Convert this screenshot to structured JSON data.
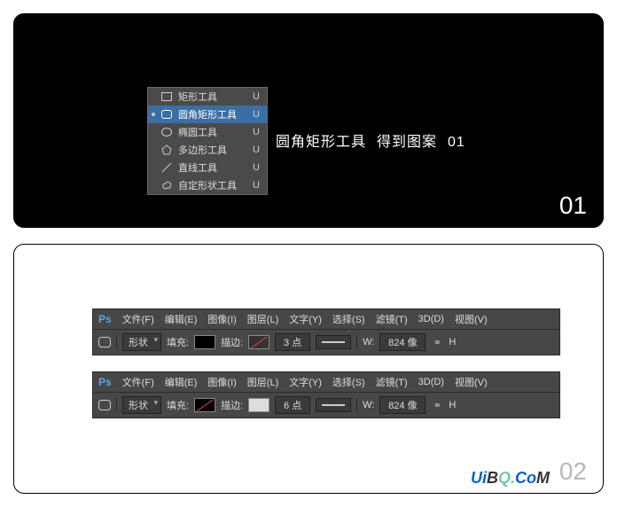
{
  "panel1": {
    "number": "01",
    "annotation": {
      "tool": "圆角矩形工具",
      "result": "得到图案",
      "idx": "01"
    },
    "tools": [
      {
        "label": "矩形工具",
        "key": "U"
      },
      {
        "label": "圆角矩形工具",
        "key": "U"
      },
      {
        "label": "椭圆工具",
        "key": "U"
      },
      {
        "label": "多边形工具",
        "key": "U"
      },
      {
        "label": "直线工具",
        "key": "U"
      },
      {
        "label": "自定形状工具",
        "key": "U"
      }
    ]
  },
  "panel2": {
    "number": "02",
    "menubar": [
      {
        "label": "文件(F)"
      },
      {
        "label": "编辑(E)"
      },
      {
        "label": "图像(I)"
      },
      {
        "label": "图层(L)"
      },
      {
        "label": "文字(Y)"
      },
      {
        "label": "选择(S)"
      },
      {
        "label": "滤镜(T)"
      },
      {
        "label": "3D(D)"
      },
      {
        "label": "视图(V)"
      }
    ],
    "bar1": {
      "mode": "形状",
      "fill_label": "填充:",
      "stroke_label": "描边:",
      "stroke_val": "3 点",
      "w_label": "W:",
      "w_val": "824 像",
      "h_label": "H"
    },
    "bar2": {
      "mode": "形状",
      "fill_label": "填充:",
      "stroke_label": "描边:",
      "stroke_val": "6 点",
      "w_label": "W:",
      "w_val": "824 像",
      "h_label": "H"
    },
    "watermark": {
      "t1": "U",
      "t2": "i",
      "t3": "B",
      "t4": "Q.",
      "t5": "C",
      "t6": "o",
      "t7": "M"
    }
  }
}
